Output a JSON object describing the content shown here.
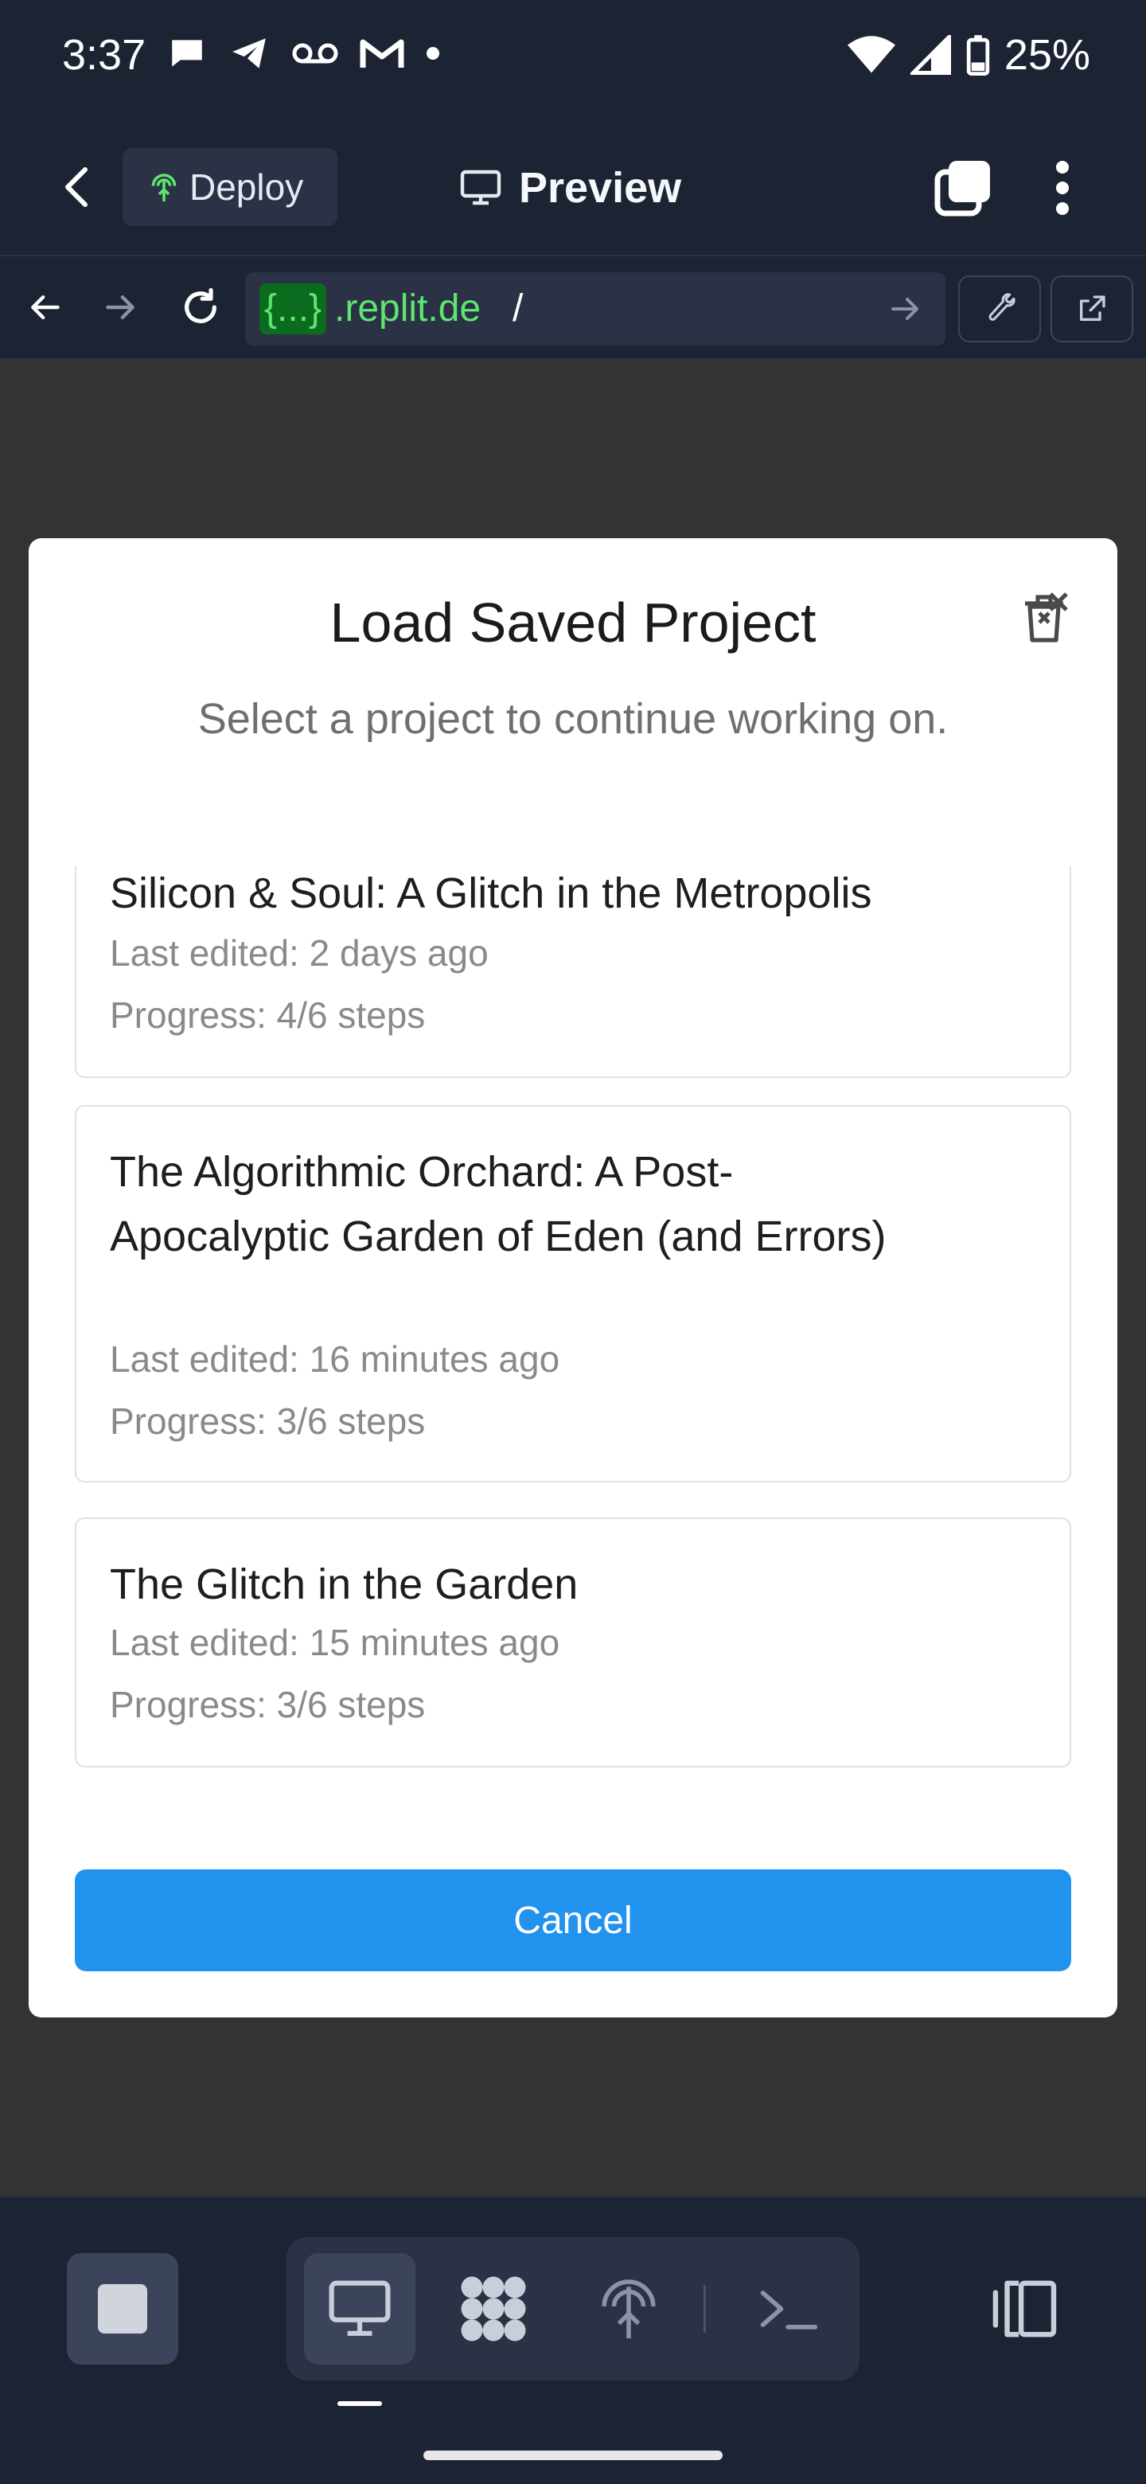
{
  "status_bar": {
    "time": "3:37",
    "battery": "25%",
    "icons": [
      "chat-bubble-icon",
      "telegram-icon",
      "voicemail-icon",
      "gmail-icon",
      "dot-icon",
      "wifi-icon",
      "signal-icon",
      "battery-icon"
    ]
  },
  "header": {
    "deploy_label": "Deploy",
    "preview_label": "Preview"
  },
  "url_bar": {
    "host_badge": "{...}",
    "host": ".replit.de",
    "path": "/"
  },
  "modal": {
    "title": "Load Saved Project",
    "subtitle": "Select a project to continue working on.",
    "cancel_label": "Cancel",
    "projects": [
      {
        "title": "Silicon & Soul: A Glitch in the Metropolis",
        "last_edited": "Last edited: 2 days ago",
        "progress": "Progress: 4/6 steps"
      },
      {
        "title": "The Algorithmic Orchard: A Post-Apocalyptic Garden of Eden (and Errors)",
        "last_edited": "Last edited: 16 minutes ago",
        "progress": "Progress: 3/6 steps"
      },
      {
        "title": "The Glitch in the Garden",
        "last_edited": "Last edited: 15 minutes ago",
        "progress": "Progress: 3/6 steps"
      }
    ]
  },
  "colors": {
    "app_bg": "#1c2333",
    "surface": "#2b3245",
    "accent": "#2192ee",
    "url_green": "#5ee56f"
  }
}
